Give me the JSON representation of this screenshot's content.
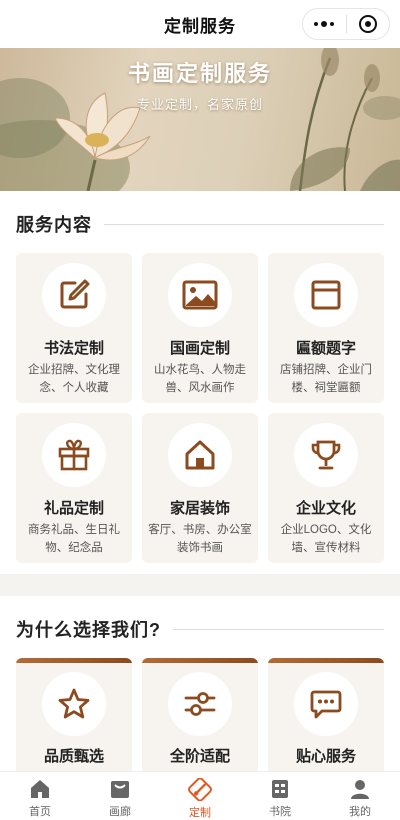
{
  "nav": {
    "title": "定制服务"
  },
  "banner": {
    "title": "书画定制服务",
    "subtitle": "专业定制，名家原创"
  },
  "services": {
    "heading": "服务内容",
    "items": [
      {
        "name": "书法定制",
        "desc": "企业招牌、文化理念、个人收藏",
        "icon": "edit-icon"
      },
      {
        "name": "国画定制",
        "desc": "山水花鸟、人物走兽、风水画作",
        "icon": "image-icon"
      },
      {
        "name": "匾额题字",
        "desc": "店铺招牌、企业门楼、祠堂匾额",
        "icon": "plaque-icon"
      },
      {
        "name": "礼品定制",
        "desc": "商务礼品、生日礼物、纪念品",
        "icon": "gift-icon"
      },
      {
        "name": "家居装饰",
        "desc": "客厅、书房、办公室装饰书画",
        "icon": "home-icon"
      },
      {
        "name": "企业文化",
        "desc": "企业LOGO、文化墙、宣传材料",
        "icon": "trophy-icon"
      }
    ]
  },
  "why": {
    "heading": "为什么选择我们?",
    "items": [
      {
        "name": "品质甄选",
        "icon": "star-icon"
      },
      {
        "name": "全阶适配",
        "icon": "sliders-icon"
      },
      {
        "name": "贴心服务",
        "icon": "chat-icon"
      }
    ]
  },
  "tabbar": {
    "items": [
      {
        "label": "首页",
        "icon": "home-tab-icon",
        "active": false
      },
      {
        "label": "画廊",
        "icon": "gallery-tab-icon",
        "active": false
      },
      {
        "label": "定制",
        "icon": "brush-tab-icon",
        "active": true
      },
      {
        "label": "书院",
        "icon": "book-tab-icon",
        "active": false
      },
      {
        "label": "我的",
        "icon": "user-tab-icon",
        "active": false
      }
    ]
  },
  "colors": {
    "accent": "#8b4b1f",
    "active_tab": "#e8541e",
    "card_bg": "#f7f4ef"
  }
}
